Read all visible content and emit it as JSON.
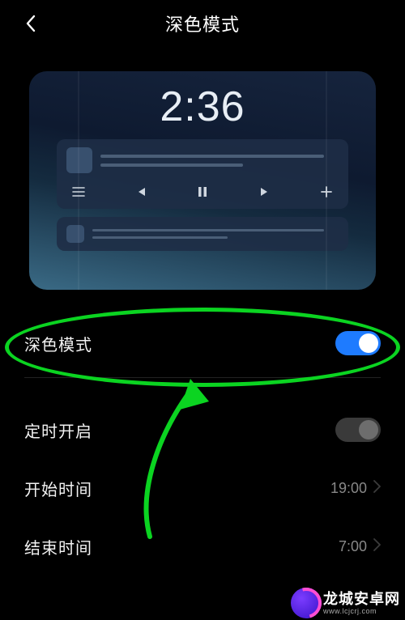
{
  "header": {
    "title": "深色模式"
  },
  "preview": {
    "clock": "2:36"
  },
  "rows": {
    "dark_mode": {
      "label": "深色模式",
      "on": true
    },
    "scheduled": {
      "label": "定时开启",
      "on": false
    },
    "start_time": {
      "label": "开始时间",
      "value": "19:00"
    },
    "end_time": {
      "label": "结束时间",
      "value": "7:00"
    }
  },
  "watermark": {
    "cn": "龙城安卓网",
    "en": "www.lcjcrj.com"
  }
}
